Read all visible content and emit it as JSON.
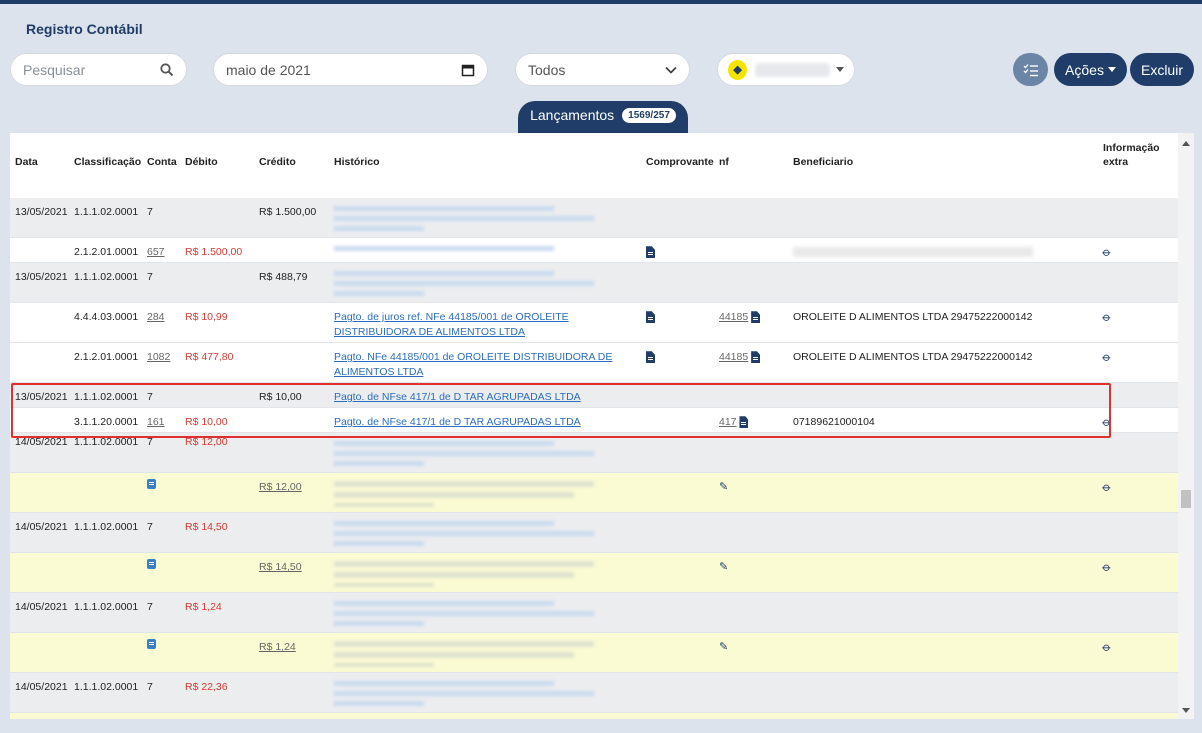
{
  "page": {
    "title": "Registro Contábil"
  },
  "toolbar": {
    "search_placeholder": "Pesquisar",
    "month_value": "maio de 2021",
    "filter_value": "Todos",
    "actions_label": "Ações",
    "delete_label": "Excluir"
  },
  "tab": {
    "label": "Lançamentos",
    "badge": "1569/257"
  },
  "columns": {
    "data": "Data",
    "classificacao": "Classificação",
    "conta": "Conta",
    "debito": "Débito",
    "credito": "Crédito",
    "historico": "Histórico",
    "comprovante": "Comprovante",
    "nf": "nf",
    "beneficiario": "Beneficiario",
    "extra_line1": "Informação",
    "extra_line2": "extra"
  },
  "rows": [
    {
      "data": "13/05/2021",
      "classificacao": "1.1.1.02.0001",
      "conta": "7",
      "debito": "",
      "credito": "R$ 1.500,00",
      "historico": "",
      "nf": "",
      "beneficiario": ""
    },
    {
      "data": "",
      "classificacao": "2.1.2.01.0001",
      "conta": "657",
      "debito": "R$ 1.500,00",
      "credito": "",
      "historico": "",
      "nf": "",
      "beneficiario": ""
    },
    {
      "data": "13/05/2021",
      "classificacao": "1.1.1.02.0001",
      "conta": "7",
      "debito": "",
      "credito": "R$ 488,79",
      "historico": "",
      "nf": "",
      "beneficiario": ""
    },
    {
      "data": "",
      "classificacao": "4.4.4.03.0001",
      "conta": "284",
      "debito": "R$ 10,99",
      "credito": "",
      "historico": "Pagto. de juros ref. NFe 44185/001 de OROLEITE DISTRIBUIDORA DE ALIMENTOS LTDA",
      "nf": "44185",
      "beneficiario": "OROLEITE D ALIMENTOS LTDA 29475222000142"
    },
    {
      "data": "",
      "classificacao": "2.1.2.01.0001",
      "conta": "1082",
      "debito": "R$ 477,80",
      "credito": "",
      "historico": "Pagto. NFe 44185/001 de OROLEITE DISTRIBUIDORA DE ALIMENTOS LTDA",
      "nf": "44185",
      "beneficiario": "OROLEITE D ALIMENTOS LTDA 29475222000142"
    },
    {
      "data": "13/05/2021",
      "classificacao": "1.1.1.02.0001",
      "conta": "7",
      "debito": "",
      "credito": "R$ 10,00",
      "historico": "Pagto. de NFse 417/1 de D TAR AGRUPADAS LTDA",
      "nf": "",
      "beneficiario": ""
    },
    {
      "data": "",
      "classificacao": "3.1.1.20.0001",
      "conta": "161",
      "debito": "R$ 10,00",
      "credito": "",
      "historico": "Pagto. de NFse 417/1 de D TAR AGRUPADAS LTDA",
      "nf": "417",
      "beneficiario": "07189621000104"
    },
    {
      "data": "14/05/2021",
      "classificacao": "1.1.1.02.0001",
      "conta": "7",
      "debito": "R$ 12,00",
      "credito": ""
    },
    {
      "data": "",
      "classificacao": "",
      "conta": "",
      "debito": "",
      "credito": "R$ 12,00"
    },
    {
      "data": "14/05/2021",
      "classificacao": "1.1.1.02.0001",
      "conta": "7",
      "debito": "R$ 14,50",
      "credito": ""
    },
    {
      "data": "",
      "classificacao": "",
      "conta": "",
      "debito": "",
      "credito": "R$ 14,50"
    },
    {
      "data": "14/05/2021",
      "classificacao": "1.1.1.02.0001",
      "conta": "7",
      "debito": "R$ 1,24",
      "credito": ""
    },
    {
      "data": "",
      "classificacao": "",
      "conta": "",
      "debito": "",
      "credito": "R$ 1,24"
    },
    {
      "data": "14/05/2021",
      "classificacao": "1.1.1.02.0001",
      "conta": "7",
      "debito": "R$ 22,36",
      "credito": ""
    }
  ],
  "colors": {
    "primary": "#1f3d68",
    "debit": "#d63a31",
    "link": "#2a6dc0",
    "highlight": "#e03030",
    "yellow_row": "#fbfbd3"
  },
  "icons": [
    "search-icon",
    "calendar-icon",
    "chevron-down-icon",
    "bank-logo",
    "checklist-icon",
    "document-icon",
    "paperclip-icon",
    "pencil-icon",
    "calculator-icon"
  ]
}
